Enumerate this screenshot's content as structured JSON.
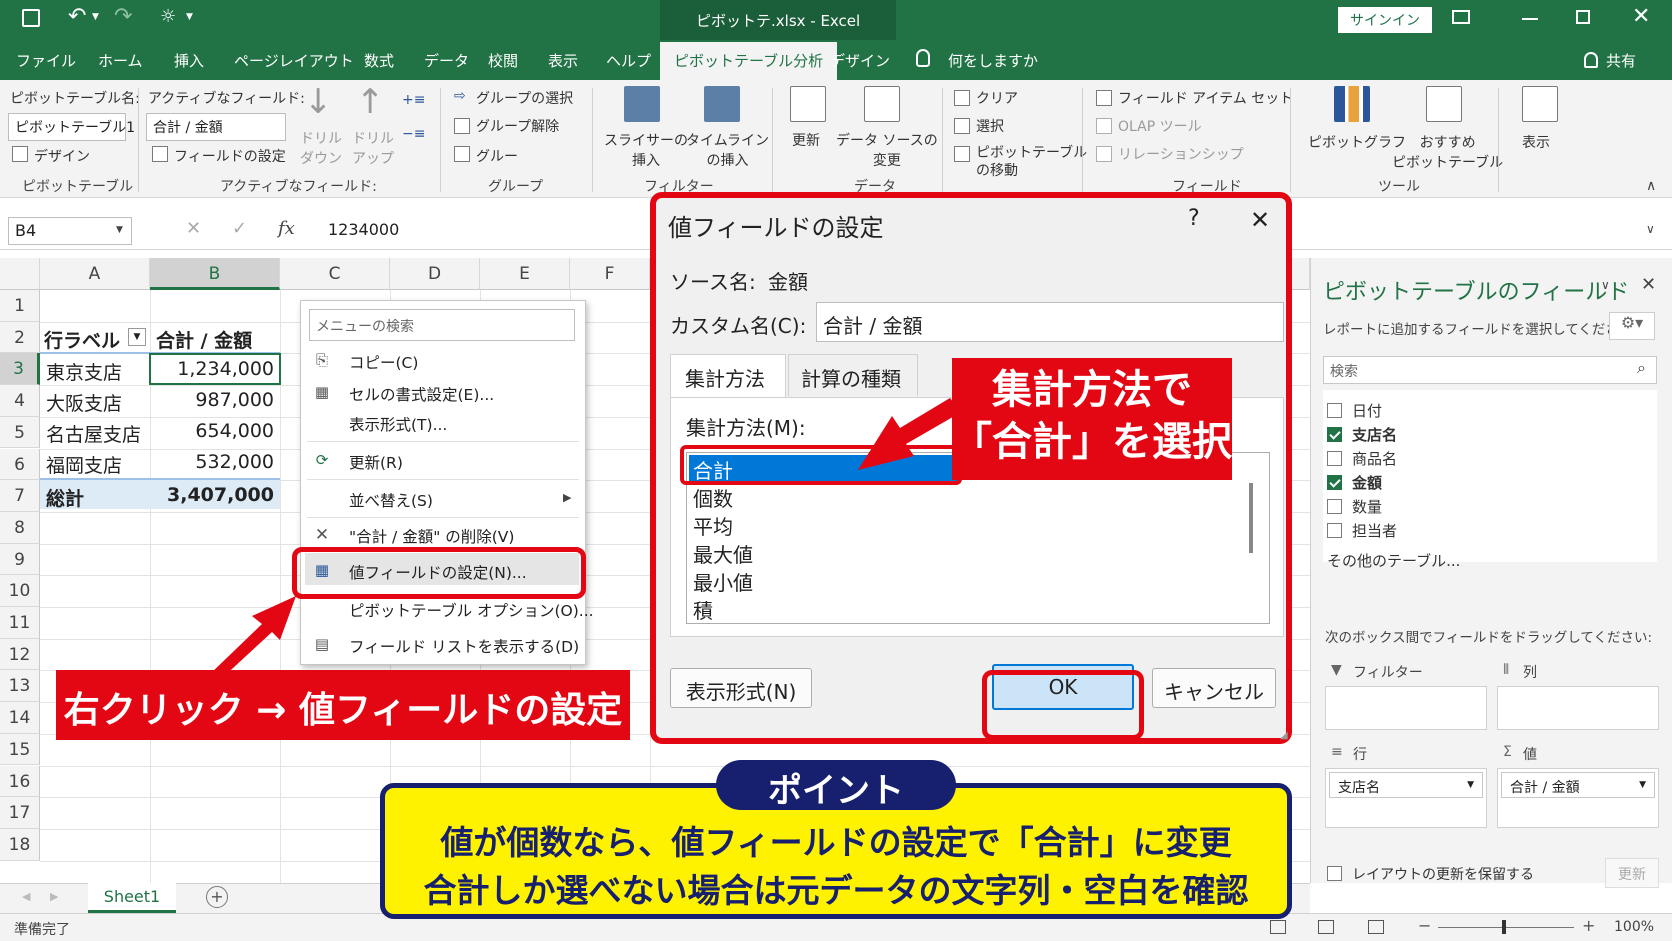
{
  "title": "ピボットテ.xlsx - Excel",
  "signin": "サインイン",
  "tabs": [
    "ファイル",
    "ホーム",
    "挿入",
    "ページレイアウト",
    "数式",
    "データ",
    "校閲",
    "表示",
    "ヘルプ",
    "ピボットテーブル分析",
    "デザイン"
  ],
  "tellme": "何をしますか",
  "share": "共有",
  "ribbon": {
    "pt_name_label": "ピボットテーブル名:",
    "pt_name": "ピボットテーブル1",
    "pt_options": "デザイン",
    "pt_group": "ピボットテーブル",
    "af_label": "アクティブなフィールド:",
    "af_value": "合計 / 金額",
    "af_settings": "フィールドの設定",
    "drill_down": "ドリル\nダウン",
    "drill_up": "ドリル\nアップ",
    "af_group": "アクティブなフィールド:",
    "grp_select": "グループの選択",
    "grp_clear": "グループ解除",
    "grp_field": "グルー",
    "grp_group": "グループ",
    "slicer": "スライサーの\n挿入",
    "timeline": "タイムライン\nの挿入",
    "filter_group": "フィルター",
    "refresh": "更新",
    "datasource": "データ ソースの\n変更",
    "data_group": "データ",
    "clear": "クリア",
    "select": "選択",
    "move": "ピボットテーブル\nの移動",
    "items_sets": "フィールド アイテム セット",
    "olap": "OLAP ツール",
    "relations": "リレーションシップ",
    "calc_group": "フィールド",
    "pivotchart": "ピボットグラフ",
    "recommended": "おすすめ\nピボットテーブル",
    "tools_group": "ツール",
    "show": "表示"
  },
  "formula": {
    "namebox": "B4",
    "value": "1234000"
  },
  "columns": [
    "A",
    "B",
    "C",
    "D",
    "E",
    "F"
  ],
  "rows": [
    "1",
    "2",
    "3",
    "4",
    "5",
    "6",
    "7",
    "8",
    "9",
    "10",
    "11",
    "12",
    "13",
    "14",
    "15",
    "16",
    "17",
    "18"
  ],
  "table": {
    "header_a": "行ラベル",
    "header_b": "合計 / 金額",
    "rows": [
      {
        "a": "東京支店",
        "b": "1,234,000"
      },
      {
        "a": "大阪支店",
        "b": "987,000"
      },
      {
        "a": "名古屋支店",
        "b": "654,000"
      },
      {
        "a": "福岡支店",
        "b": "532,000"
      }
    ],
    "total_a": "総計",
    "total_b": "3,407,000"
  },
  "context_menu": {
    "search": "メニューの検索",
    "items": [
      "コピー(C)",
      "セルの書式設定(E)...",
      "表示形式(T)...",
      "更新(R)",
      "並べ替え(S)",
      "\"合計 / 金額\" の削除(V)",
      "値フィールドの設定(N)...",
      "ピボットテーブル オプション(O)...",
      "フィールド リストを表示する(D)"
    ]
  },
  "dialog": {
    "title": "値フィールドの設定",
    "help": "?",
    "close": "✕",
    "source_label": "ソース名:",
    "source_value": "金額",
    "custom_label": "カスタム名(C):",
    "custom_value": "合計 / 金額",
    "tab1": "集計方法",
    "tab2": "計算の種類",
    "method_label": "集計方法(M):",
    "methods": [
      "合計",
      "個数",
      "平均",
      "最大値",
      "最小値",
      "積"
    ],
    "format_btn": "表示形式(N)",
    "ok": "OK",
    "cancel": "キャンセル"
  },
  "pane": {
    "title": "ピボットテーブルのフィールド",
    "subtitle": "レポートに追加するフィールドを選択してください:",
    "search": "検索",
    "fields": [
      {
        "name": "日付",
        "checked": false
      },
      {
        "name": "支店名",
        "checked": true
      },
      {
        "name": "商品名",
        "checked": false
      },
      {
        "name": "金額",
        "checked": true
      },
      {
        "name": "数量",
        "checked": false
      },
      {
        "name": "担当者",
        "checked": false
      }
    ],
    "more": "その他のテーブル...",
    "drag_hint": "次のボックス間でフィールドをドラッグしてください:",
    "filter": "フィルター",
    "cols": "列",
    "rows": "行",
    "values": "値",
    "row_item": "支店名",
    "value_item": "合計 / 金額",
    "defer": "レイアウトの更新を保留する",
    "update": "更新"
  },
  "sheet_tab": "Sheet1",
  "status": {
    "ready": "準備完了",
    "zoom": "100%"
  },
  "callouts": {
    "right_click": "右クリック → 値フィールドの設定",
    "choose_sum_1": "集計方法で",
    "choose_sum_2": "「合計」を選択",
    "point_tag": "ポイント",
    "point_1": "値が個数なら、値フィールドの設定で「合計」に変更",
    "point_2": "合計しか選べない場合は元データの文字列・空白を確認"
  },
  "colors": {
    "excel_green": "#217346",
    "callout_red": "#e30613",
    "point_yellow": "#fff200",
    "point_navy": "#17206e",
    "select_blue": "#0078d7"
  }
}
